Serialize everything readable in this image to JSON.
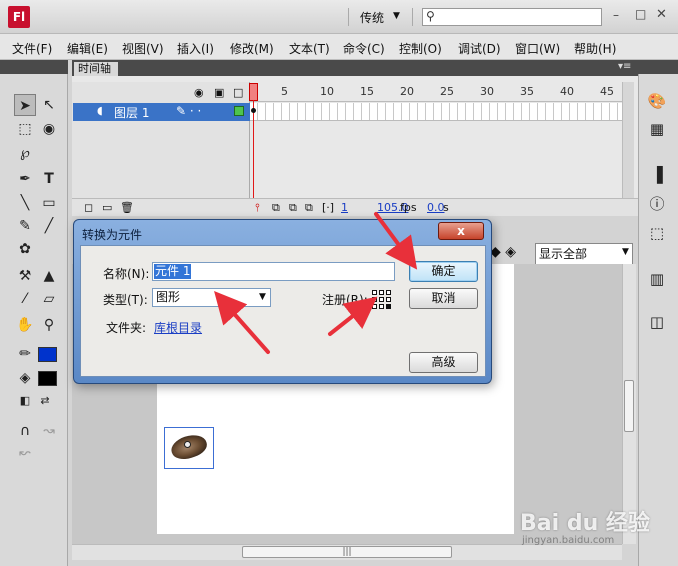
{
  "app": {
    "logo": "Fl",
    "workspace": "传统",
    "search_placeholder": ""
  },
  "window_controls": {
    "minimize": "–",
    "maximize": "□",
    "close": "✕"
  },
  "menu": [
    "文件(F)",
    "编辑(E)",
    "视图(V)",
    "插入(I)",
    "修改(M)",
    "文本(T)",
    "命令(C)",
    "控制(O)",
    "调试(D)",
    "窗口(W)",
    "帮助(H)"
  ],
  "timeline": {
    "tab": "时间轴",
    "layer_name": "图层 1",
    "frame_numbers": [
      "1",
      "5",
      "10",
      "15",
      "20",
      "25",
      "30",
      "35",
      "40",
      "45"
    ],
    "status_frame": "1",
    "status_fps": "105.0",
    "fps_unit": "fps",
    "status_time": "0.0",
    "time_unit": "s"
  },
  "stage": {
    "zoom": "显示全部"
  },
  "dialog": {
    "title": "转换为元件",
    "name_label": "名称(N):",
    "name_value": "元件 1",
    "type_label": "类型(T):",
    "type_value": "图形",
    "registration_label": "注册(R):",
    "folder_label": "文件夹:",
    "folder_value": "库根目录",
    "ok_button": "确定",
    "cancel_button": "取消",
    "advanced_button": "高级",
    "close_glyph": "x"
  },
  "watermark": {
    "text": "Bai du 经验",
    "url": "jingyan.baidu.com"
  },
  "colors": {
    "stroke": "#0033cc",
    "fill": "#000000",
    "selection": "#3a73c7",
    "annotation": "#e8303a"
  },
  "icons": {
    "left_tools": [
      "selection-icon",
      "subselection-icon",
      "free-transform-icon",
      "3d-rotation-icon",
      "lasso-icon",
      "pen-icon",
      "text-icon",
      "line-icon",
      "rectangle-icon",
      "pencil-icon",
      "brush-icon",
      "deco-icon",
      "bone-icon",
      "paint-bucket-icon",
      "ink-bottle-icon",
      "eyedropper-icon",
      "eraser-icon",
      "hand-icon",
      "zoom-icon"
    ],
    "right_tools": [
      "color-palette-icon",
      "swatches-icon",
      "align-icon",
      "info-icon",
      "transform-icon",
      "library-icon",
      "components-icon"
    ]
  }
}
